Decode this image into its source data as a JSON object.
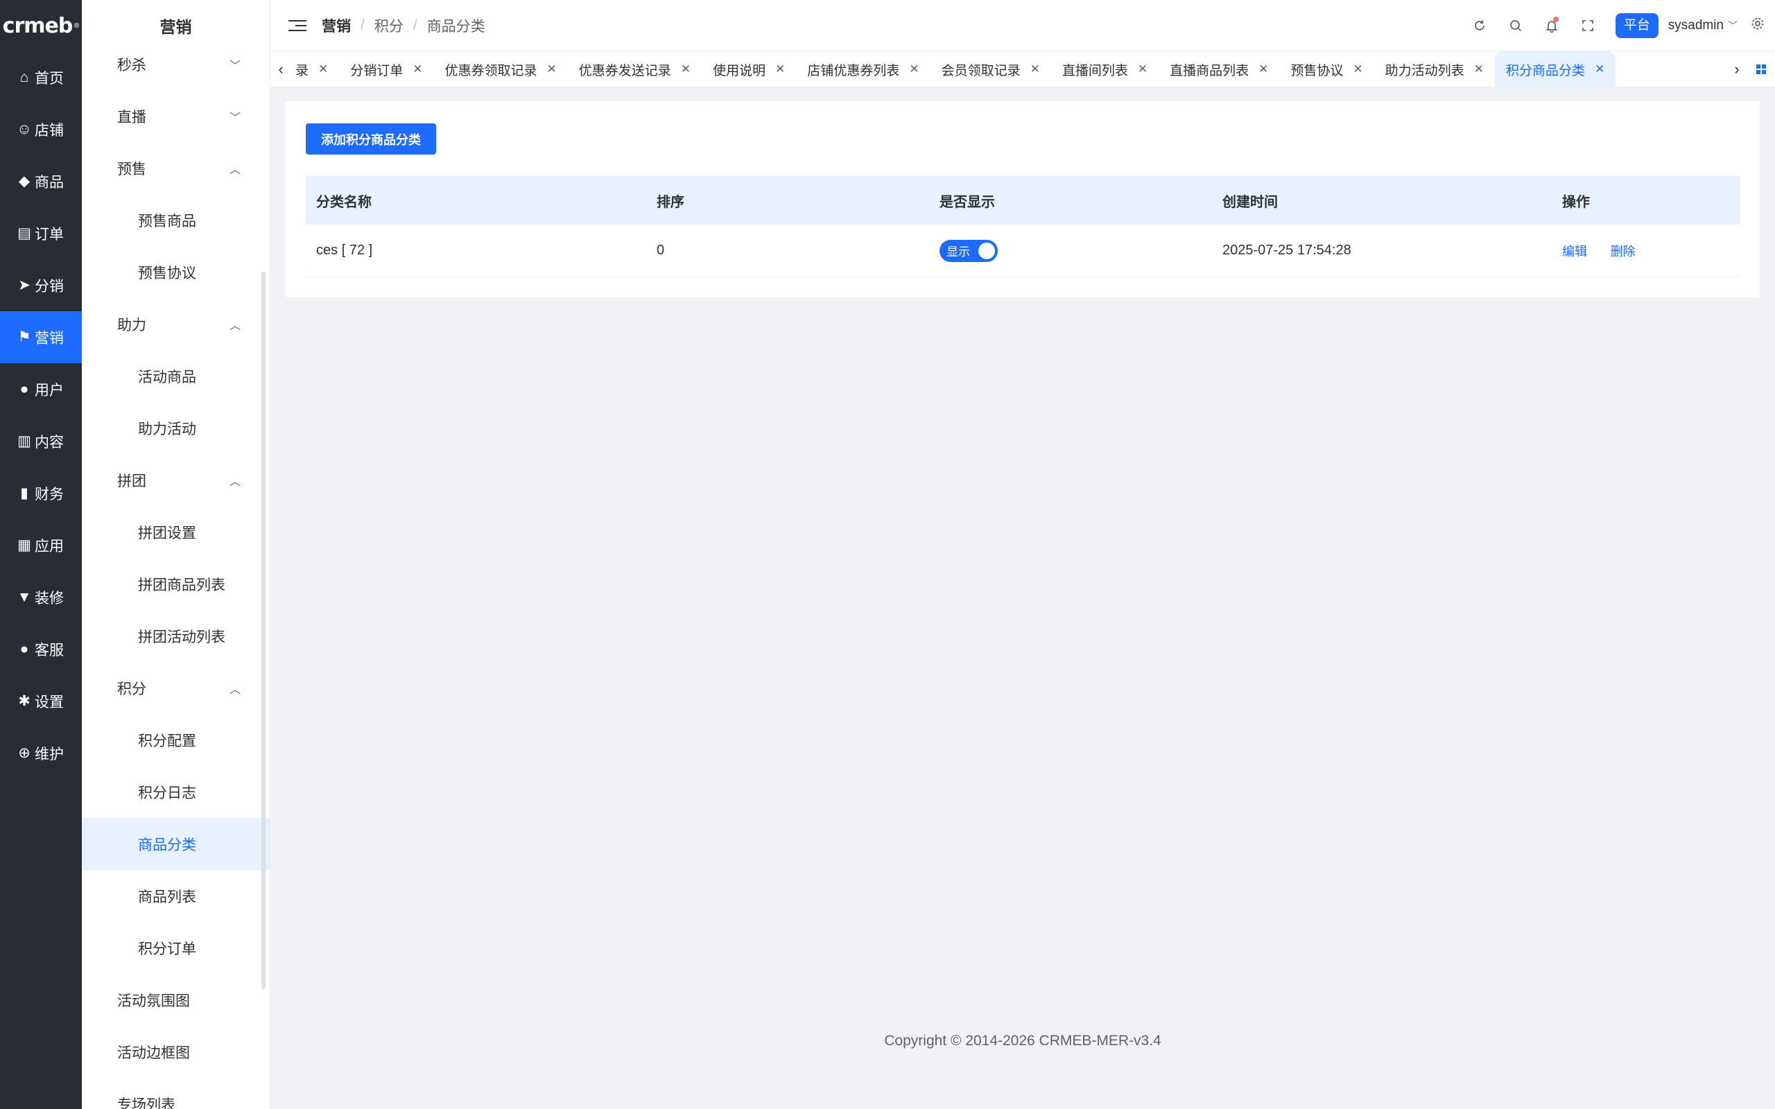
{
  "logo": "crmeb",
  "rail": [
    {
      "label": "首页",
      "icon": "home-icon",
      "glyph": "⌂"
    },
    {
      "label": "店铺",
      "icon": "store-icon",
      "glyph": "☺"
    },
    {
      "label": "商品",
      "icon": "bag-icon",
      "glyph": "◆"
    },
    {
      "label": "订单",
      "icon": "clipboard-icon",
      "glyph": "▤"
    },
    {
      "label": "分销",
      "icon": "send-icon",
      "glyph": "➤"
    },
    {
      "label": "营销",
      "icon": "flag-icon",
      "glyph": "⚑"
    },
    {
      "label": "用户",
      "icon": "user-icon",
      "glyph": "●"
    },
    {
      "label": "内容",
      "icon": "book-icon",
      "glyph": "▥"
    },
    {
      "label": "财务",
      "icon": "bar-chart-icon",
      "glyph": "▮"
    },
    {
      "label": "应用",
      "icon": "grid-icon",
      "glyph": "▦"
    },
    {
      "label": "装修",
      "icon": "brush-icon",
      "glyph": "▼"
    },
    {
      "label": "客服",
      "icon": "headset-icon",
      "glyph": "●"
    },
    {
      "label": "设置",
      "icon": "gear-icon",
      "glyph": "✱"
    },
    {
      "label": "维护",
      "icon": "maintenance-icon",
      "glyph": "⊕"
    }
  ],
  "submenu": {
    "title": "营销",
    "groups": [
      {
        "label": "秒杀",
        "expanded": false
      },
      {
        "label": "直播",
        "expanded": false
      },
      {
        "label": "预售",
        "expanded": true,
        "items": [
          "预售商品",
          "预售协议"
        ]
      },
      {
        "label": "助力",
        "expanded": true,
        "items": [
          "活动商品",
          "助力活动"
        ]
      },
      {
        "label": "拼团",
        "expanded": true,
        "items": [
          "拼团设置",
          "拼团商品列表",
          "拼团活动列表"
        ]
      },
      {
        "label": "积分",
        "expanded": true,
        "items": [
          "积分配置",
          "积分日志",
          "商品分类",
          "商品列表",
          "积分订单"
        ]
      },
      {
        "label": "活动氛围图"
      },
      {
        "label": "活动边框图"
      },
      {
        "label": "专场列表"
      }
    ]
  },
  "header": {
    "breadcrumb": [
      "营销",
      "积分",
      "商品分类"
    ],
    "platform_badge": "平台",
    "username": "sysadmin"
  },
  "tabs": [
    {
      "label": "录",
      "active": false
    },
    {
      "label": "分销订单",
      "active": false
    },
    {
      "label": "优惠券领取记录",
      "active": false
    },
    {
      "label": "优惠券发送记录",
      "active": false
    },
    {
      "label": "使用说明",
      "active": false
    },
    {
      "label": "店铺优惠券列表",
      "active": false
    },
    {
      "label": "会员领取记录",
      "active": false
    },
    {
      "label": "直播间列表",
      "active": false
    },
    {
      "label": "直播商品列表",
      "active": false
    },
    {
      "label": "预售协议",
      "active": false
    },
    {
      "label": "助力活动列表",
      "active": false
    },
    {
      "label": "积分商品分类",
      "active": true
    }
  ],
  "main": {
    "add_button": "添加积分商品分类",
    "columns": [
      "分类名称",
      "排序",
      "是否显示",
      "创建时间",
      "操作"
    ],
    "rows": [
      {
        "name": "ces [ 72 ]",
        "sort": "0",
        "show_label": "显示",
        "show": true,
        "created": "2025-07-25 17:54:28",
        "actions": [
          "编辑",
          "删除"
        ]
      }
    ]
  },
  "footer": "Copyright © 2014-2026 CRMEB-MER-v3.4",
  "colors": {
    "accent": "#1d6bff",
    "rail_bg": "#282c34",
    "page_bg": "#f0f2f5"
  }
}
